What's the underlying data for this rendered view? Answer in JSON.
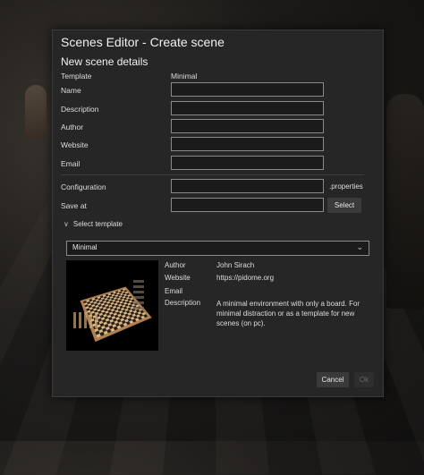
{
  "dialog": {
    "title": "Scenes Editor - Create scene",
    "section_title": "New scene details",
    "template_label": "Template",
    "template_value": "Minimal",
    "name_label": "Name",
    "description_label": "Description",
    "author_label": "Author",
    "website_label": "Website",
    "email_label": "Email",
    "configuration_label": "Configuration",
    "configuration_suffix": ".properties",
    "save_at_label": "Save at",
    "select_button": "Select",
    "select_template_label": "Select template",
    "template_dropdown_value": "Minimal",
    "info": {
      "author_label": "Author",
      "author_value": "John Sirach",
      "website_label": "Website",
      "website_value": "https://pidome.org",
      "email_label": "Email",
      "email_value": "",
      "description_label": "Description",
      "description_value": "A minimal environment with only a board. For minimal distraction or as a template for new scenes (on pc)."
    },
    "cancel_button": "Cancel",
    "ok_button": "Ok"
  },
  "icons": {
    "expander": "chevron-down-icon",
    "dropdown": "chevron-down-icon"
  }
}
